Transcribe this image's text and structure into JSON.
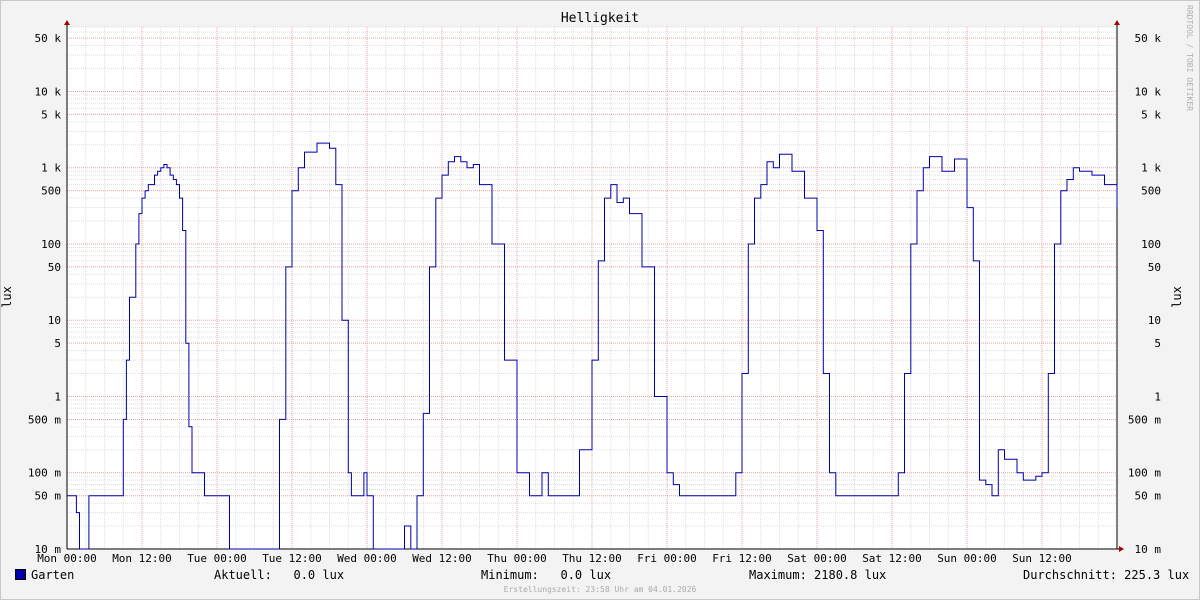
{
  "chart_data": {
    "type": "line",
    "title": "Helligkeit",
    "ylabel": "lux",
    "ylabel_right": "lux",
    "scale": "log",
    "ylim": [
      0.01,
      70
    ],
    "grid": true,
    "x_ticks": [
      "Mon 00:00",
      "Mon 12:00",
      "Tue 00:00",
      "Tue 12:00",
      "Wed 00:00",
      "Wed 12:00",
      "Thu 00:00",
      "Thu 12:00",
      "Fri 00:00",
      "Fri 12:00",
      "Sat 00:00",
      "Sat 12:00",
      "Sun 00:00",
      "Sun 12:00"
    ],
    "y_ticks": [
      {
        "value": 50,
        "label": "50 k"
      },
      {
        "value": 10,
        "label": "10 k"
      },
      {
        "value": 5,
        "label": "5 k"
      },
      {
        "value": 1,
        "label": "1 k"
      },
      {
        "value": 0.5,
        "label": "500"
      },
      {
        "value": 0.1,
        "label": "100"
      },
      {
        "value": 0.05,
        "label": "50"
      },
      {
        "value": 0.01,
        "label": "10"
      },
      {
        "value": 0.005,
        "label": "5"
      },
      {
        "value": 0.001,
        "label": "1"
      },
      {
        "value": 0.0005,
        "label": "500 m"
      },
      {
        "value": 0.0001,
        "label": "100 m"
      },
      {
        "value": 5e-05,
        "label": "50 m"
      },
      {
        "value": 1e-05,
        "label": "10 m"
      }
    ],
    "series": [
      {
        "name": "Garten",
        "color": "#0000aa",
        "x_hours": [
          0,
          1,
          1.5,
          2,
          2.5,
          3,
          3.5,
          4,
          5,
          6,
          7,
          7.5,
          8,
          8.5,
          9,
          9.5,
          10,
          11,
          11.5,
          12,
          12.5,
          13,
          14,
          14.5,
          15,
          15.5,
          16,
          16.5,
          17,
          17.5,
          18,
          18.5,
          19,
          19.5,
          20,
          21,
          22,
          23,
          24,
          26,
          28,
          30,
          32,
          33,
          34,
          35,
          36,
          37,
          38,
          40,
          42,
          43,
          44,
          45,
          45.5,
          46,
          47,
          47.5,
          48,
          49,
          49.5,
          50,
          52,
          53,
          54,
          55,
          56,
          57,
          58,
          59,
          60,
          61,
          62,
          63,
          64,
          65,
          66,
          68,
          70,
          72,
          72.5,
          73,
          74,
          75,
          76,
          77,
          78,
          79,
          80,
          81,
          82,
          83,
          84,
          85,
          86,
          87,
          88,
          89,
          90,
          92,
          94,
          96,
          97,
          98,
          99,
          100,
          101,
          102,
          103,
          104,
          105,
          106,
          107,
          108,
          109,
          110,
          111,
          112,
          113,
          114,
          116,
          118,
          120,
          121,
          122,
          123,
          124,
          125,
          126,
          127,
          128,
          129,
          130,
          131,
          132,
          133,
          134,
          135,
          136,
          137,
          138,
          140,
          142,
          144,
          145,
          146,
          147,
          148,
          149,
          150,
          151,
          152,
          153,
          154,
          155,
          156,
          157,
          158,
          159,
          160,
          161,
          162,
          164,
          166,
          168
        ],
        "values_klux": [
          5e-05,
          5e-05,
          3e-05,
          1e-05,
          1e-05,
          1e-05,
          5e-05,
          5e-05,
          5e-05,
          5e-05,
          5e-05,
          5e-05,
          5e-05,
          5e-05,
          0.0005,
          0.003,
          0.02,
          0.1,
          0.25,
          0.4,
          0.5,
          0.6,
          0.8,
          0.9,
          1.0,
          1.1,
          1.0,
          0.8,
          0.7,
          0.6,
          0.4,
          0.15,
          0.005,
          0.0004,
          0.0001,
          0.0001,
          5e-05,
          5e-05,
          5e-05,
          1e-05,
          1e-05,
          1e-05,
          1e-05,
          1e-05,
          0.0005,
          0.05,
          0.5,
          1.0,
          1.6,
          2.1,
          1.8,
          0.6,
          0.01,
          0.0001,
          5e-05,
          5e-05,
          5e-05,
          0.0001,
          5e-05,
          1e-05,
          1e-05,
          1e-05,
          1e-05,
          1e-05,
          2e-05,
          1e-05,
          5e-05,
          0.0006,
          0.05,
          0.4,
          0.8,
          1.2,
          1.4,
          1.2,
          1.0,
          1.1,
          0.6,
          0.1,
          0.003,
          0.0001,
          0.0001,
          0.0001,
          5e-05,
          5e-05,
          0.0001,
          5e-05,
          5e-05,
          5e-05,
          5e-05,
          5e-05,
          0.0002,
          0.0002,
          0.003,
          0.06,
          0.4,
          0.6,
          0.35,
          0.4,
          0.25,
          0.05,
          0.001,
          0.0001,
          7e-05,
          5e-05,
          5e-05,
          5e-05,
          5e-05,
          5e-05,
          5e-05,
          5e-05,
          5e-05,
          5e-05,
          0.0001,
          0.002,
          0.1,
          0.4,
          0.6,
          1.2,
          1.0,
          1.5,
          0.9,
          0.4,
          0.15,
          0.002,
          0.0001,
          5e-05,
          5e-05,
          5e-05,
          5e-05,
          5e-05,
          5e-05,
          5e-05,
          5e-05,
          5e-05,
          5e-05,
          0.0001,
          0.002,
          0.1,
          0.5,
          1.0,
          1.4,
          0.9,
          1.3,
          0.3,
          0.06,
          8e-05,
          7e-05,
          5e-05,
          0.0002,
          0.00015,
          0.00015,
          0.0001,
          8e-05,
          8e-05,
          9e-05,
          0.0001,
          0.002,
          0.1,
          0.5,
          0.7,
          1.0,
          0.9,
          0.8,
          0.6,
          0.3,
          0.04,
          0.0001,
          5e-05,
          5e-05
        ]
      }
    ]
  },
  "legend": {
    "series_name": "Garten",
    "aktuell_label": "Aktuell:",
    "aktuell_value": "0.0 lux",
    "minimum_label": "Minimum:",
    "minimum_value": "0.0 lux",
    "maximum_label": "Maximum:",
    "maximum_value": "2180.8 lux",
    "durchschnitt_label": "Durchschnitt:",
    "durchschnitt_value": "225.3 lux"
  },
  "watermark": "RRDTOOL / TOBI OETIKER",
  "footer": "Erstellungszeit: 23:58 Uhr am 04.01.2026"
}
